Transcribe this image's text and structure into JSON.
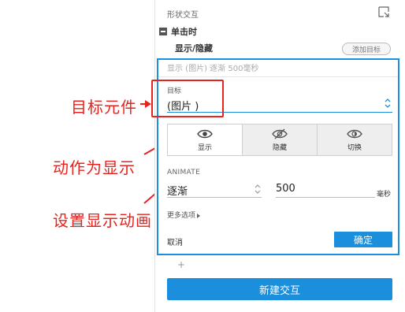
{
  "panel": {
    "header_title": "形状交互",
    "event_label": "单击时",
    "action_label": "显示/隐藏",
    "add_target_label": "添加目标"
  },
  "editor": {
    "summary": "显示 (图片) 逐渐 500毫秒",
    "target_label": "目标",
    "target_value": "(图片 )",
    "visibility_options": [
      {
        "label": "显示",
        "icon": "eye-icon",
        "selected": true
      },
      {
        "label": "隐藏",
        "icon": "eye-slash-icon",
        "selected": false
      },
      {
        "label": "切换",
        "icon": "eye-toggle-icon",
        "selected": false
      }
    ],
    "animate_label": "ANIMATE",
    "easing_value": "逐渐",
    "duration_value": "500",
    "duration_unit": "毫秒",
    "more_options_label": "更多选项",
    "cancel_label": "取消",
    "ok_label": "确定"
  },
  "new_interaction_label": "新建交互",
  "annotations": {
    "target": "目标元件",
    "action": "动作为显示",
    "animation": "设置显示动画"
  },
  "colors": {
    "accent": "#1c8fdc",
    "annotation": "#e8231f"
  }
}
